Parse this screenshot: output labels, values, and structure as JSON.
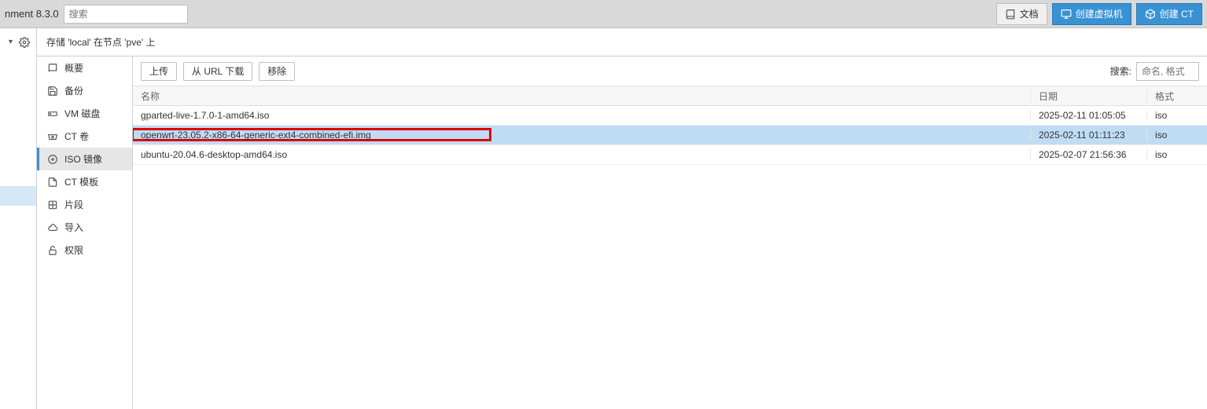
{
  "version_text": "nment 8.3.0",
  "top_search_placeholder": "搜索",
  "docs_label": "文档",
  "create_vm_label": "创建虚拟机",
  "create_ct_label": "创建 CT",
  "breadcrumb": "存储 'local' 在节点 'pve' 上",
  "sidebar": [
    {
      "icon": "book",
      "label": "概要"
    },
    {
      "icon": "save",
      "label": "备份"
    },
    {
      "icon": "hdd",
      "label": "VM 磁盘"
    },
    {
      "icon": "disc",
      "label": "CT 卷"
    },
    {
      "icon": "cd",
      "label": "ISO 镜像"
    },
    {
      "icon": "file",
      "label": "CT 模板"
    },
    {
      "icon": "puzzle",
      "label": "片段"
    },
    {
      "icon": "cloud",
      "label": "导入"
    },
    {
      "icon": "unlock",
      "label": "权限"
    }
  ],
  "active_sidebar": 4,
  "toolbar": {
    "upload": "上传",
    "from_url": "从 URL 下载",
    "remove": "移除",
    "search_label": "搜索:",
    "search_placeholder": "命名, 格式"
  },
  "columns": {
    "name": "名称",
    "date": "日期",
    "fmt": "格式"
  },
  "rows": [
    {
      "name": "gparted-live-1.7.0-1-amd64.iso",
      "date": "2025-02-11 01:05:05",
      "fmt": "iso",
      "selected": false,
      "highlighted": false
    },
    {
      "name": "openwrt-23.05.2-x86-64-generic-ext4-combined-efi.img",
      "date": "2025-02-11 01:11:23",
      "fmt": "iso",
      "selected": true,
      "highlighted": true
    },
    {
      "name": "ubuntu-20.04.6-desktop-amd64.iso",
      "date": "2025-02-07 21:56:36",
      "fmt": "iso",
      "selected": false,
      "highlighted": false
    }
  ]
}
